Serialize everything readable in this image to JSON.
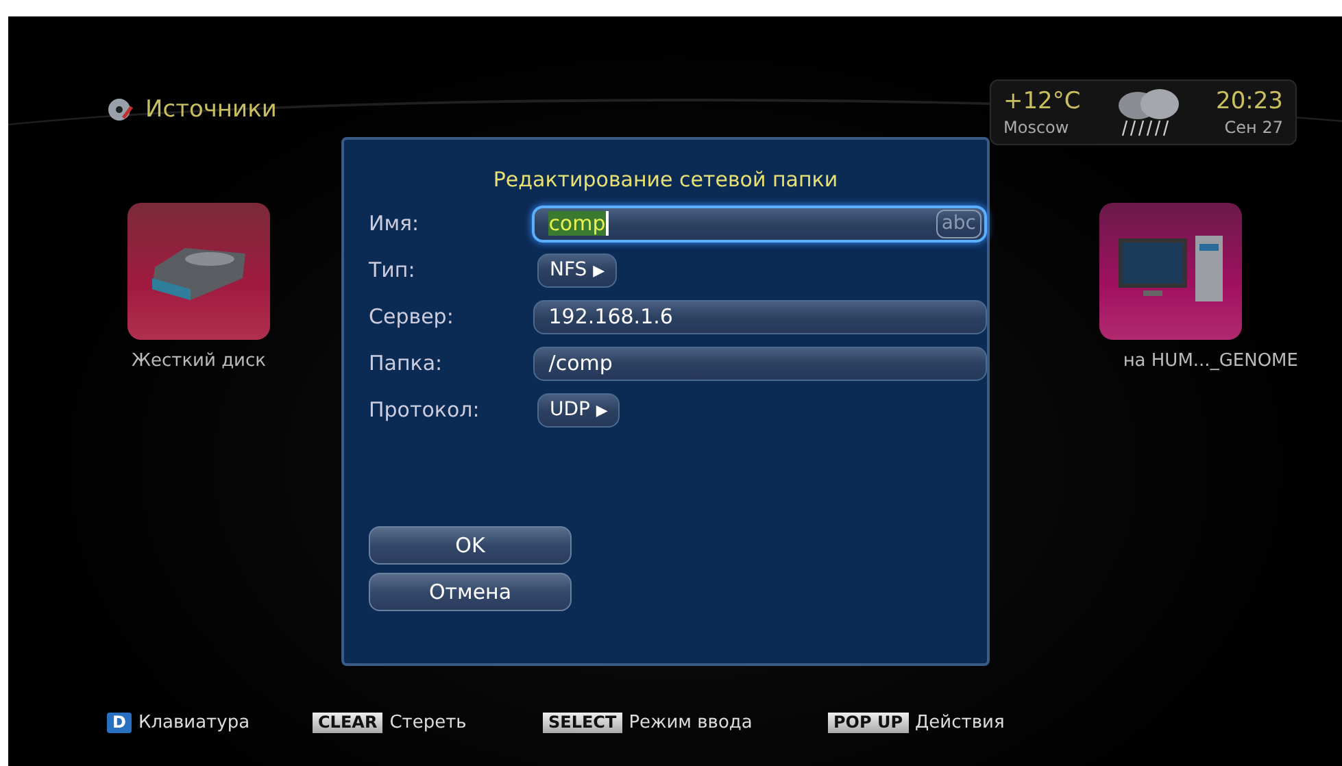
{
  "header": {
    "title": "Источники"
  },
  "weather": {
    "temperature": "+12°C",
    "city": "Moscow",
    "time": "20:23",
    "date": "Сен 27"
  },
  "sources": [
    {
      "label": "Жесткий диск",
      "kind": "disk"
    },
    {
      "label": "на HUM..._GENOME",
      "kind": "computer"
    }
  ],
  "dialog": {
    "title": "Редактирование сетевой папки",
    "fields": [
      {
        "label": "Имя:",
        "kind": "text",
        "value": "comp",
        "focused": true,
        "mode": "abc"
      },
      {
        "label": "Тип:",
        "kind": "choice",
        "value": "NFS",
        "arrow": "▶"
      },
      {
        "label": "Сервер:",
        "kind": "text",
        "value": "192.168.1.6",
        "focused": false
      },
      {
        "label": "Папка:",
        "kind": "text",
        "value": "/comp",
        "focused": false
      },
      {
        "label": "Протокол:",
        "kind": "choice",
        "value": "UDP",
        "arrow": "▶"
      }
    ],
    "buttons": [
      "OK",
      "Отмена"
    ]
  },
  "hints": [
    {
      "key": "D",
      "label": "Клавиатура",
      "kind": "color"
    },
    {
      "key": "CLEAR",
      "label": "Стереть",
      "kind": "plain"
    },
    {
      "key": "SELECT",
      "label": "Режим ввода",
      "kind": "plain"
    },
    {
      "key": "POP UP",
      "label": "Действия",
      "kind": "plain"
    }
  ]
}
